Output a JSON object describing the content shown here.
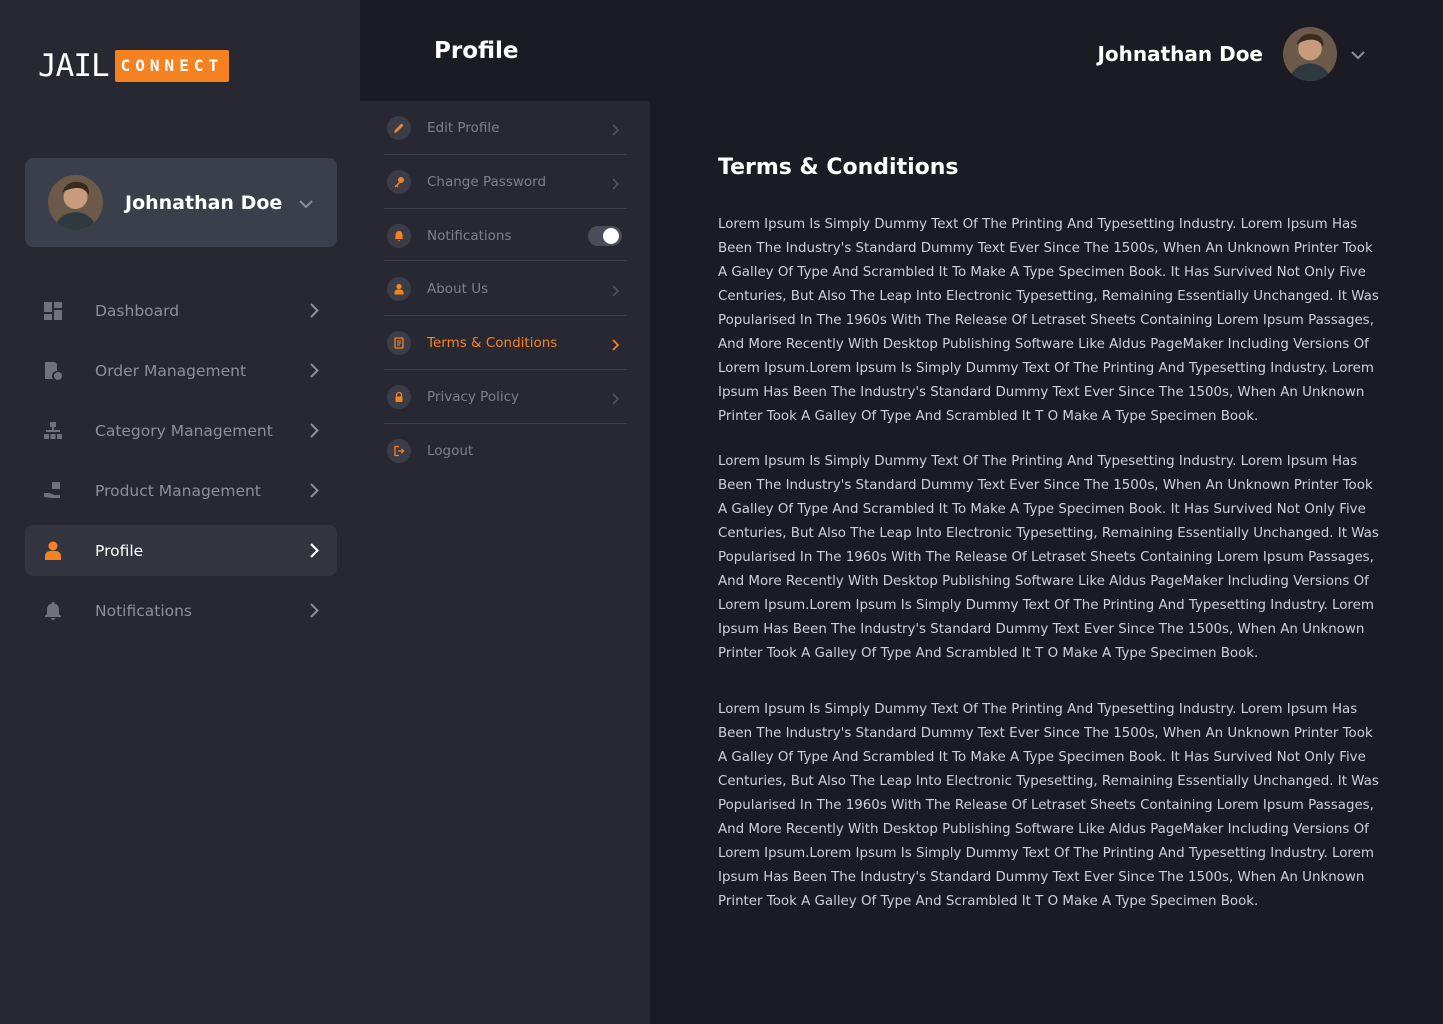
{
  "brand": {
    "logo_left": "JAIL",
    "logo_right": "CONNECT",
    "accent": "#f58220"
  },
  "sidebar": {
    "user_name": "Johnathan Doe",
    "items": [
      {
        "label": "Dashboard",
        "icon": "dashboard-icon"
      },
      {
        "label": "Order Management",
        "icon": "order-icon"
      },
      {
        "label": "Category Management",
        "icon": "category-icon"
      },
      {
        "label": "Product Management",
        "icon": "product-icon"
      },
      {
        "label": "Profile",
        "icon": "profile-icon",
        "active": true
      },
      {
        "label": "Notifications",
        "icon": "bell-icon"
      }
    ]
  },
  "header": {
    "title": "Profile",
    "user_name": "Johnathan Doe"
  },
  "submenu": {
    "items": [
      {
        "label": "Edit Profile",
        "icon": "pencil-icon"
      },
      {
        "label": "Change Password",
        "icon": "key-icon"
      },
      {
        "label": "Notifications",
        "icon": "bell-icon",
        "toggle": true
      },
      {
        "label": "About Us",
        "icon": "user-icon"
      },
      {
        "label": "Terms & Conditions",
        "icon": "document-icon",
        "active": true
      },
      {
        "label": "Privacy Policy",
        "icon": "lock-icon"
      },
      {
        "label": "Logout",
        "icon": "logout-icon"
      }
    ]
  },
  "content": {
    "title": "Terms & Conditions",
    "paragraphs": [
      "Lorem Ipsum Is Simply Dummy Text Of The Printing And Typesetting Industry. Lorem Ipsum Has Been The Industry's Standard Dummy Text Ever Since The 1500s, When An Unknown Printer Took A Galley Of Type And Scrambled It To Make A Type Specimen Book. It Has Survived Not Only Five Centuries, But Also The Leap Into Electronic Typesetting, Remaining Essentially Unchanged. It Was Popularised In The 1960s With The Release Of Letraset Sheets Containing Lorem Ipsum Passages, And More Recently With Desktop Publishing Software Like Aldus PageMaker Including Versions Of Lorem Ipsum.Lorem Ipsum Is Simply Dummy Text Of The Printing And Typesetting Industry. Lorem Ipsum Has Been The Industry's Standard Dummy Text Ever Since The 1500s, When An Unknown Printer Took A Galley Of Type And Scrambled It T     O Make A Type Specimen Book.",
      "Lorem Ipsum Is Simply Dummy Text Of The Printing And Typesetting Industry. Lorem Ipsum Has Been The Industry's Standard Dummy Text Ever Since The 1500s, When An Unknown Printer Took A Galley Of Type And Scrambled It To Make A Type Specimen Book. It Has Survived Not Only Five Centuries, But Also The Leap Into Electronic Typesetting, Remaining Essentially Unchanged. It Was Popularised In The 1960s With The Release Of Letraset Sheets Containing Lorem Ipsum Passages, And More Recently With Desktop Publishing Software Like Aldus PageMaker Including Versions Of Lorem Ipsum.Lorem Ipsum Is Simply Dummy Text Of The Printing And Typesetting Industry. Lorem Ipsum Has Been The Industry's Standard Dummy Text Ever Since The 1500s, When An Unknown Printer Took A Galley Of Type And Scrambled It T     O Make A Type Specimen Book.",
      "Lorem Ipsum Is Simply Dummy Text Of The Printing And Typesetting Industry. Lorem Ipsum Has Been The Industry's Standard Dummy Text Ever Since The 1500s, When An Unknown Printer Took A Galley Of Type And Scrambled It To Make A Type Specimen Book. It Has Survived Not Only Five Centuries, But Also The Leap Into Electronic Typesetting, Remaining Essentially Unchanged. It Was Popularised In The 1960s With The Release Of Letraset Sheets Containing Lorem Ipsum Passages, And More Recently With Desktop Publishing Software Like Aldus PageMaker Including Versions Of Lorem Ipsum.Lorem Ipsum Is Simply Dummy Text Of The Printing And Typesetting Industry. Lorem Ipsum Has Been The Industry's Standard Dummy Text Ever Since The 1500s, When An Unknown Printer Took A Galley Of Type And Scrambled It T     O Make A Type Specimen Book."
    ]
  }
}
